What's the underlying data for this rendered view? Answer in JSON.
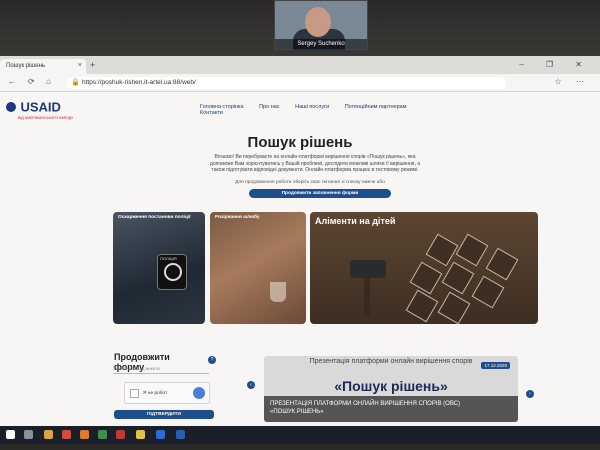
{
  "video_call": {
    "participant_name": "Sergey Suchenko"
  },
  "browser": {
    "tab_title": "Пошук рішень",
    "tab_close": "×",
    "new_tab": "+",
    "window_controls": "– ❐ ✕",
    "url": "https://poshuk-rishen.it-artel.ua:88/web/",
    "back": "←",
    "reload": "⟳",
    "home": "⌂",
    "lock": "🔒",
    "toolbar_icons": "☆ ⋯"
  },
  "site": {
    "logo_text": "USAID",
    "logo_sub": "ВІД АМЕРИКАНСЬКОГО НАРОДУ",
    "nav": [
      "Головна сторінка",
      "Про нас",
      "Наші послуги",
      "Потенційним партнерам",
      "Контакти"
    ],
    "title": "Пошук рішень",
    "intro": "Вітаємо! Ви перебуваєте на онлайн-платформі вирішення спорів «Пошук рішень», яка допоможе Вам зорієнтуватись у Вашій проблемі, дослідити можливі шляхи її вирішення, а також підготувати відповідні документи. Онлайн-платформа працює в тестовому режимі.",
    "select_hint": "Для продовження роботи оберіть своє питання зі списку нижче або",
    "continue_button": "Продовжити заповнення форми",
    "cards": [
      {
        "label": "Оскарження постанови поліції"
      },
      {
        "label": "Розірвання шлюбу"
      },
      {
        "label": "Аліменти на дітей"
      }
    ],
    "police_badge": "ПОЛІЦІЯ",
    "form": {
      "title": "Продовжити форму",
      "help": "?",
      "input_placeholder": "Унікальний код анкети",
      "captcha_label": "Я не робот",
      "submit": "ПІДТВЕРДИТИ"
    },
    "slider": {
      "date": "17.12.2020",
      "heading": "Презентація платформи онлайн вирішення спорів",
      "big_title": "«Пошук рішень»",
      "caption_line1": "ПРЕЗЕНТАЦІЯ ПЛАТФОРМИ ОНЛАЙН ВИРІШЕННЯ СПОРІВ (ОВС)",
      "caption_line2": "«ПОШУК РІШЕНЬ»",
      "prev": "‹",
      "next": "›"
    }
  },
  "colors": {
    "brand_blue": "#1f4e8c",
    "usaid_navy": "#1a3a7a"
  }
}
